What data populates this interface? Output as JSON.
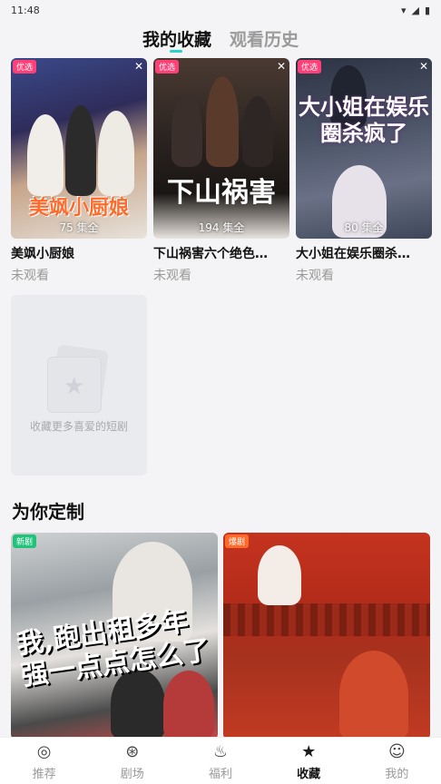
{
  "status_bar": {
    "time": "11:48"
  },
  "top_tabs": [
    {
      "label": "我的收藏",
      "active": true
    },
    {
      "label": "观看历史",
      "active": false
    }
  ],
  "favorites": [
    {
      "title": "美飒小厨娘",
      "poster_text": "美飒小厨娘",
      "badge": "优选",
      "episodes": "75 集全",
      "status": "未观看"
    },
    {
      "title": "下山祸害六个绝色…",
      "poster_text": "下山祸害",
      "badge": "优选",
      "episodes": "194 集全",
      "status": "未观看"
    },
    {
      "title": "大小姐在娱乐圈杀…",
      "poster_text": "大小姐在娱乐圈杀疯了",
      "badge": "优选",
      "episodes": "80 集全",
      "status": "未观看"
    }
  ],
  "empty_card": {
    "text": "收藏更多喜爱的短剧"
  },
  "section": {
    "title": "为你定制"
  },
  "recommendations": [
    {
      "tag": "新剧",
      "poster_text": "我,跑出租多年强一点点怎么了"
    },
    {
      "tag": "爆剧",
      "poster_text": ""
    }
  ],
  "nav": [
    {
      "label": "推荐",
      "icon": "planet-icon",
      "glyph": "◎",
      "active": false
    },
    {
      "label": "剧场",
      "icon": "film-reel-icon",
      "glyph": "⊛",
      "active": false
    },
    {
      "label": "福利",
      "icon": "gift-pot-icon",
      "glyph": "♨",
      "active": false
    },
    {
      "label": "收藏",
      "icon": "folder-star-icon",
      "glyph": "★",
      "active": true
    },
    {
      "label": "我的",
      "icon": "smile-icon",
      "glyph": "☺",
      "active": false
    }
  ],
  "colors": {
    "accent": "#28d3c8",
    "badge": "#ff3f78",
    "new_tag": "#21c27a",
    "hot_tag": "#ff6a2a"
  }
}
